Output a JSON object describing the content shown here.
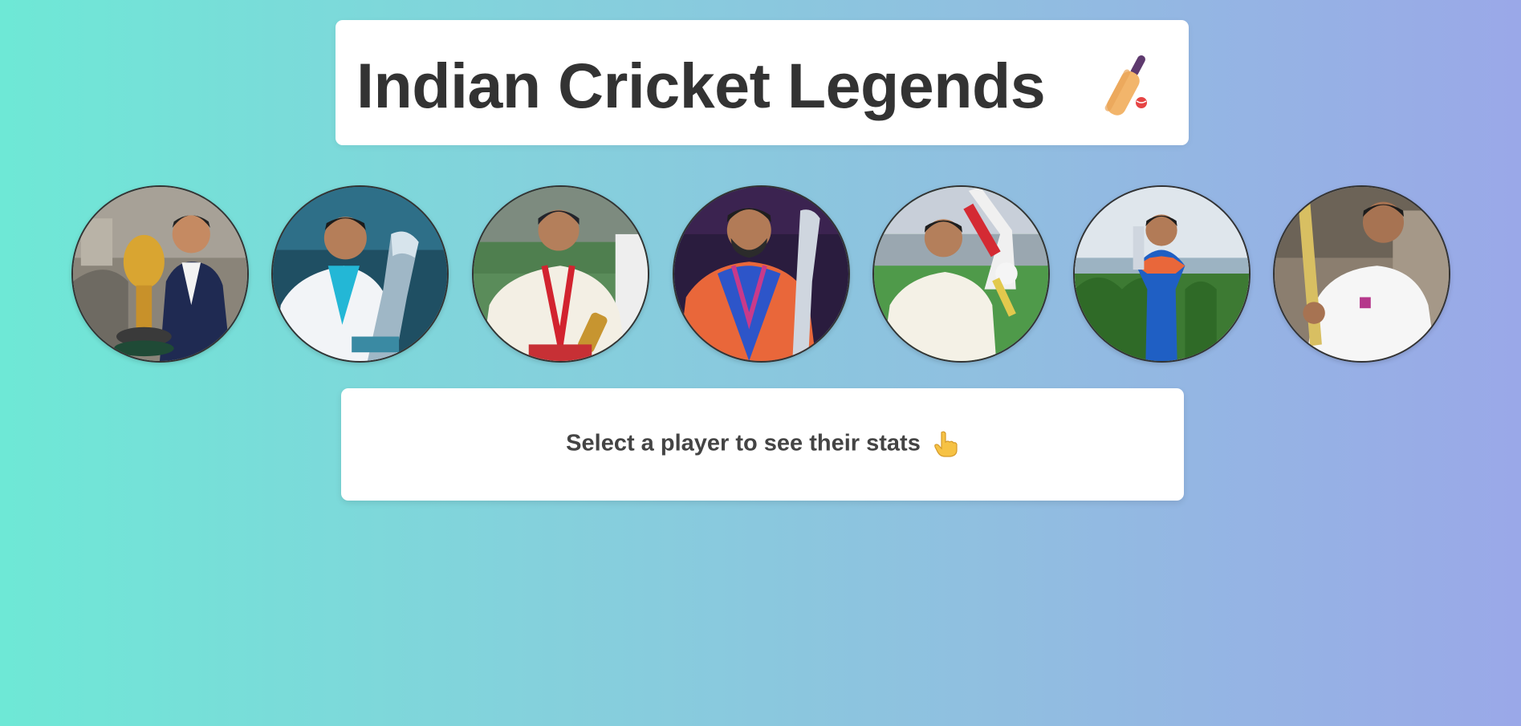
{
  "header": {
    "title": "Indian Cricket Legends",
    "icon": "cricket-bat-ball-icon"
  },
  "players": [
    {
      "id": "player-1",
      "photo": "player holding world cup trophy, navy blazer",
      "jersey_color": "#1f2a52"
    },
    {
      "id": "player-2",
      "photo": "player in white blazer holding silver trophy",
      "jersey_color": "#f2f4f7"
    },
    {
      "id": "player-3",
      "photo": "player in test whites with medal",
      "jersey_color": "#f3efe4"
    },
    {
      "id": "player-4",
      "photo": "player in orange and blue india jersey with trophy",
      "jersey_color": "#2d55c9"
    },
    {
      "id": "player-5",
      "photo": "player in test whites raising bat",
      "jersey_color": "#f4f1e6"
    },
    {
      "id": "player-6",
      "photo": "player in blue india kit holding trophy",
      "jersey_color": "#1f5fc4"
    },
    {
      "id": "player-7",
      "photo": "player in whites raising bat",
      "jersey_color": "#f6f6f6"
    }
  ],
  "stats_panel": {
    "prompt": "Select a player to see their stats",
    "icon": "pointing-hand-icon"
  },
  "colors": {
    "background_start": "#6ee8d6",
    "background_end": "#9aa8e8",
    "title_text": "#333333",
    "prompt_text": "#444444",
    "card_bg": "#ffffff"
  }
}
